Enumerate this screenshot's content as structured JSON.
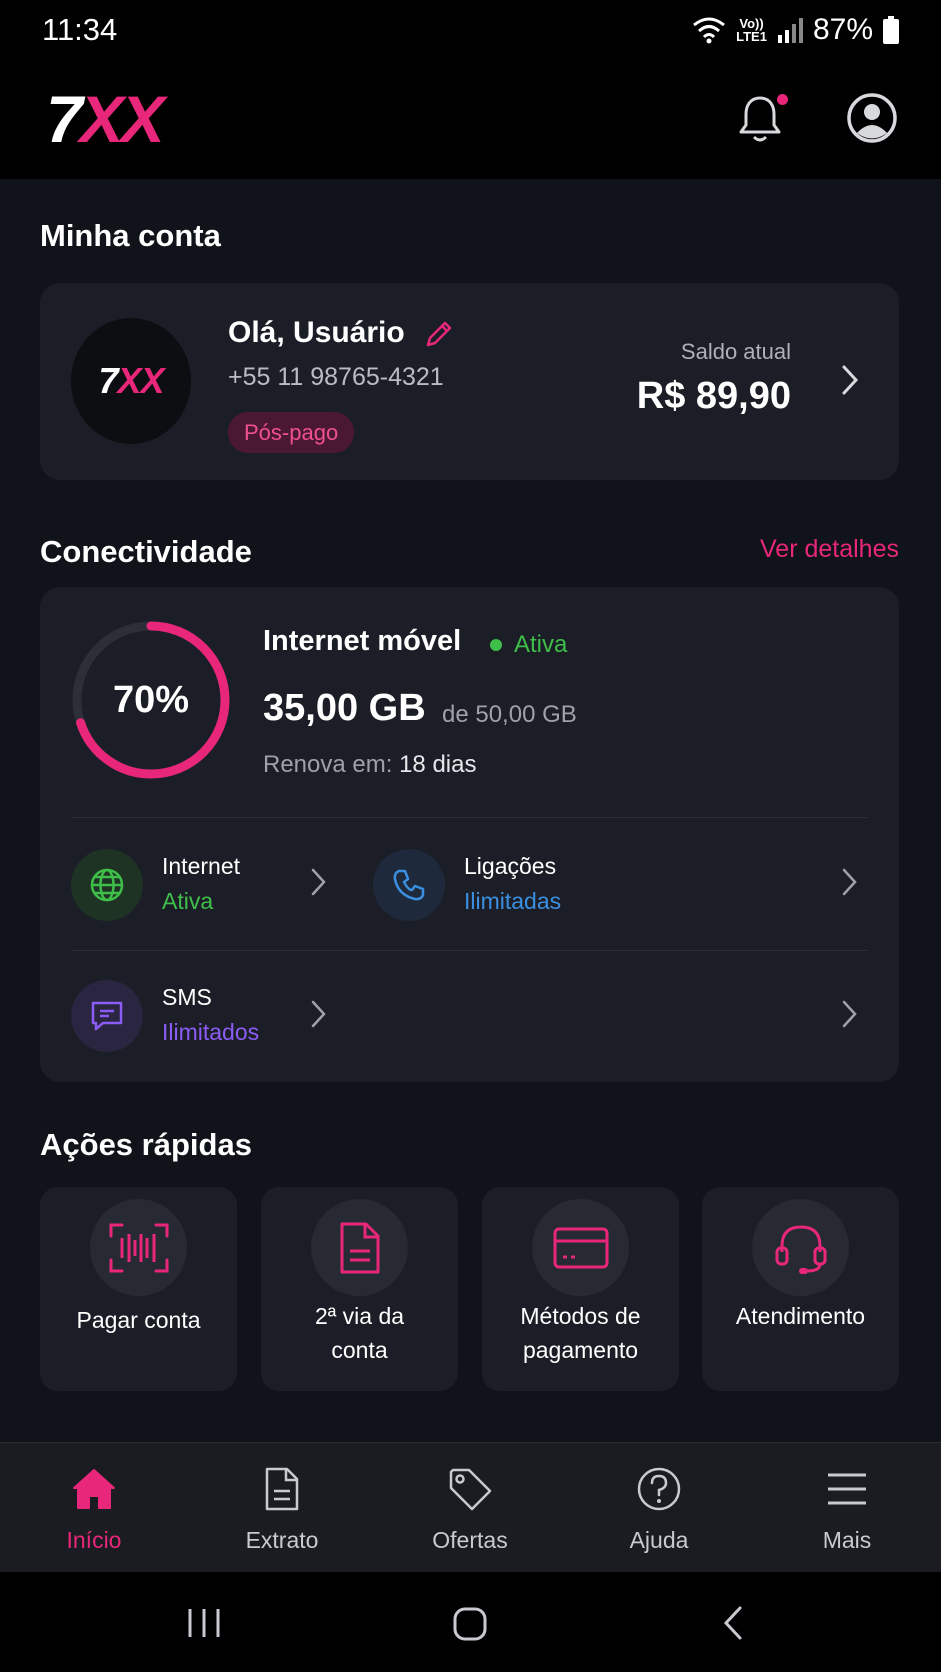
{
  "status_bar": {
    "time": "11:34",
    "volte_top": "Vo))",
    "volte_bottom": "LTE1",
    "battery": "87%"
  },
  "header": {
    "logo_seven": "7",
    "logo_xx": "XX"
  },
  "account": {
    "section_title": "Minha conta",
    "avatar_seven": "7",
    "avatar_xx": "XX",
    "greeting": "Olá, Usuário",
    "phone": "+55 11 98765-4321",
    "plan_badge": "Pós-pago",
    "balance_label": "Saldo atual",
    "balance_value": "R$ 89,90"
  },
  "connectivity": {
    "section_title": "Conectividade",
    "details_link": "Ver detalhes",
    "usage_percent": 70,
    "usage_percent_label": "70%",
    "plan_name": "Internet móvel",
    "plan_status": "Ativa",
    "used": "35,00 GB",
    "of_total": "de 50,00 GB",
    "renew_label": "Renova em:",
    "renew_value": "18 dias",
    "services": [
      {
        "title": "Internet",
        "subtitle": "Ativa",
        "color": "#3fbf4a",
        "icon": "globe-icon"
      },
      {
        "title": "Ligações",
        "subtitle": "Ilimitadas",
        "color": "#3b8fe0",
        "icon": "phone-icon"
      },
      {
        "title": "SMS",
        "subtitle": "Ilimitados",
        "color": "#8b5cf6",
        "icon": "message-icon"
      }
    ]
  },
  "quick_actions": {
    "section_title": "Ações rápidas",
    "items": [
      {
        "line1": "Pagar conta",
        "line2": "",
        "icon": "barcode-icon"
      },
      {
        "line1": "2ª via da",
        "line2": "conta",
        "icon": "document-icon"
      },
      {
        "line1": "Métodos de",
        "line2": "pagamento",
        "icon": "credit-card-icon"
      },
      {
        "line1": "Atendimento",
        "line2": "",
        "icon": "headset-icon"
      }
    ]
  },
  "bottom_nav": [
    {
      "label": "Início",
      "icon": "home-icon",
      "active": true
    },
    {
      "label": "Extrato",
      "icon": "document-icon",
      "active": false
    },
    {
      "label": "Ofertas",
      "icon": "tag-icon",
      "active": false
    },
    {
      "label": "Ajuda",
      "icon": "help-icon",
      "active": false
    },
    {
      "label": "Mais",
      "icon": "menu-icon",
      "active": false
    }
  ],
  "colors": {
    "accent": "#e8277a",
    "card": "#1b1e26",
    "background": "#101319",
    "success": "#3fbf4a"
  }
}
